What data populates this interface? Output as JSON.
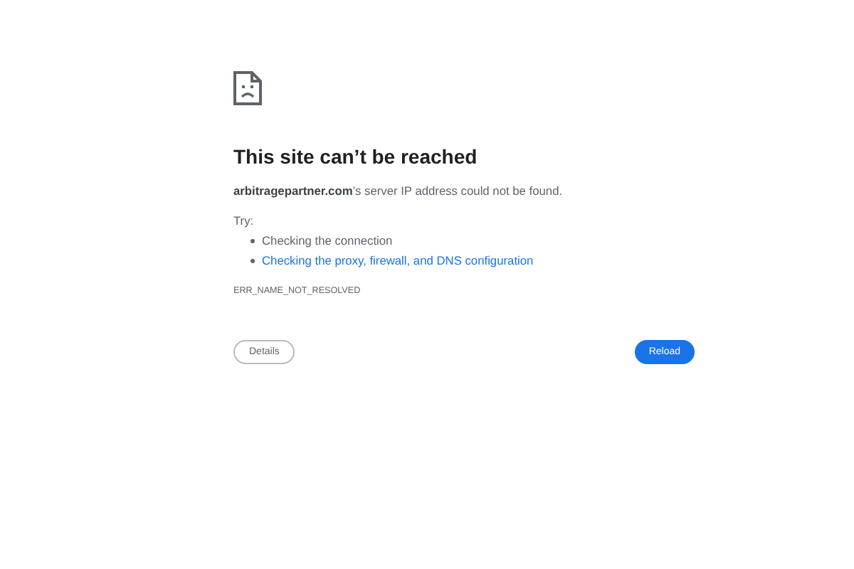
{
  "heading": "This site can’t be reached",
  "message": "**arbitragepartner.com**’s server IP address could not be found.",
  "try_label": "Try:",
  "suggestions": [
    {
      "kind": "text",
      "text": "Checking the connection"
    },
    {
      "kind": "link",
      "text": "Checking the proxy, firewall, and DNS configuration"
    }
  ],
  "error_code": "ERR_NAME_NOT_RESOLVED",
  "buttons": [
    {
      "kind": "secondary",
      "label": "Details"
    },
    {
      "kind": "primary",
      "label": "Reload"
    }
  ]
}
